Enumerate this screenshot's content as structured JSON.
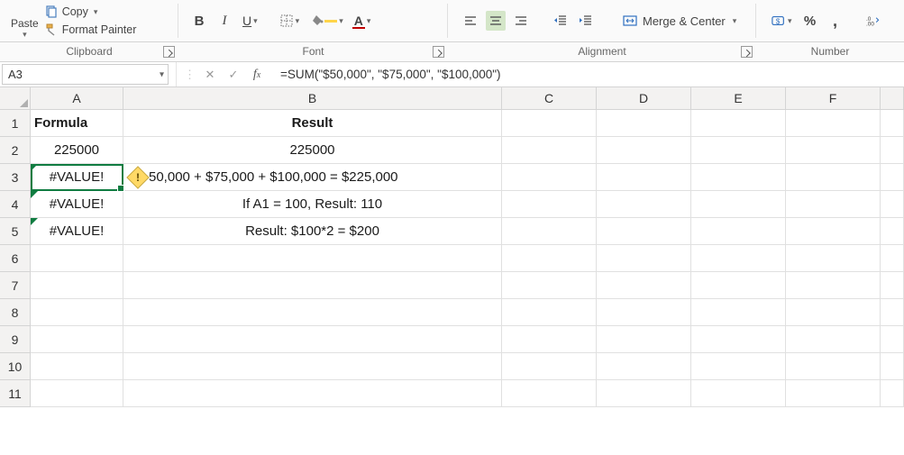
{
  "ribbon": {
    "paste_label": "Paste",
    "copy_label": "Copy",
    "format_painter_label": "Format Painter",
    "bold": "B",
    "italic": "I",
    "underline": "U",
    "merge_center_label": "Merge & Center"
  },
  "group_labels": {
    "clipboard": "Clipboard",
    "font": "Font",
    "alignment": "Alignment",
    "number": "Number"
  },
  "formula_bar": {
    "name_box": "A3",
    "formula": "=SUM(\"$50,000\", \"$75,000\", \"$100,000\")"
  },
  "columns": [
    "A",
    "B",
    "C",
    "D",
    "E",
    "F"
  ],
  "rows": [
    "1",
    "2",
    "3",
    "4",
    "5",
    "6",
    "7",
    "8",
    "9",
    "10",
    "11"
  ],
  "cells": {
    "A1": "Formula",
    "B1": "Result",
    "A2": "225000",
    "B2": "225000",
    "A3": "#VALUE!",
    "B3": "$50,000 + $75,000 + $100,000 = $225,000",
    "B3_visible_prefix": "50,000 + $75,000 + $100,000 = $225,000",
    "A4": "#VALUE!",
    "B4": "If A1 = 100, Result: 110",
    "A5": "#VALUE!",
    "B5": "Result: $100*2 = $200"
  },
  "active_cell": "A3",
  "error_indicator": "!"
}
